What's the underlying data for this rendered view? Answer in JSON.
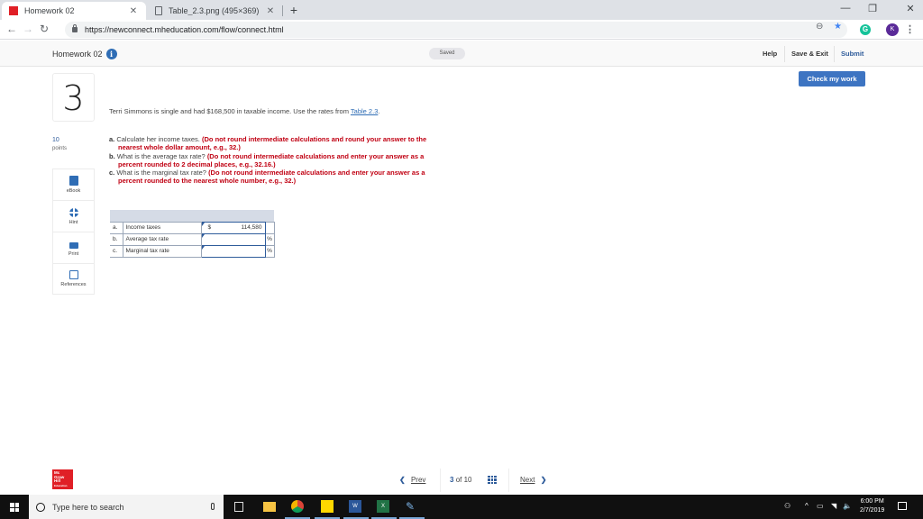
{
  "browser": {
    "tabs": [
      {
        "title": "Homework 02",
        "active": true
      },
      {
        "title": "Table_2.3.png (495×369)",
        "active": false
      }
    ],
    "url": "https://newconnect.mheducation.com/flow/connect.html",
    "profile_initial": "K",
    "grammarly_initial": "G"
  },
  "header": {
    "title": "Homework 02",
    "info_glyph": "i",
    "status": "Saved",
    "links": {
      "help": "Help",
      "save_exit": "Save & Exit",
      "submit": "Submit"
    }
  },
  "check_button": "Check my work",
  "question": {
    "number": "3",
    "points_value": "10",
    "points_label": "points",
    "intro": "Terri Simmons is single and had $168,500 in taxable income. Use the rates from ",
    "intro_link": "Table 2.3",
    "intro_end": ".",
    "parts": [
      {
        "letter": "a.",
        "text": " Calculate her income taxes. ",
        "instruction": "(Do not round intermediate calculations and round your answer to the nearest whole dollar amount, e.g., 32.)"
      },
      {
        "letter": "b.",
        "text": " What is the average tax rate? ",
        "instruction": "(Do not round intermediate calculations and enter your answer as a percent rounded to 2 decimal places, e.g., 32.16.)"
      },
      {
        "letter": "c.",
        "text": " What is the marginal tax rate? ",
        "instruction": "(Do not round intermediate calculations and enter your answer as a percent rounded to the nearest whole number, e.g., 32.)"
      }
    ]
  },
  "tools": [
    {
      "label": "eBook",
      "icon": "book-icon"
    },
    {
      "label": "Hint",
      "icon": "hint-icon"
    },
    {
      "label": "Print",
      "icon": "print-icon"
    },
    {
      "label": "References",
      "icon": "references-icon"
    }
  ],
  "answer_table": {
    "rows": [
      {
        "letter": "a.",
        "label": "Income taxes",
        "currency": "$",
        "value": "114,580",
        "unit": ""
      },
      {
        "letter": "b.",
        "label": "Average tax rate",
        "currency": "",
        "value": "",
        "unit": "%"
      },
      {
        "letter": "c.",
        "label": "Marginal tax rate",
        "currency": "",
        "value": "",
        "unit": "%"
      }
    ]
  },
  "footer": {
    "logo_lines": [
      "Mc",
      "Graw",
      "Hill",
      "Education"
    ],
    "prev": "Prev",
    "current": "3",
    "of_total": "of 10",
    "next": "Next"
  },
  "taskbar": {
    "search_placeholder": "Type here to search",
    "time": "6:00 PM",
    "date": "2/7/2019"
  }
}
